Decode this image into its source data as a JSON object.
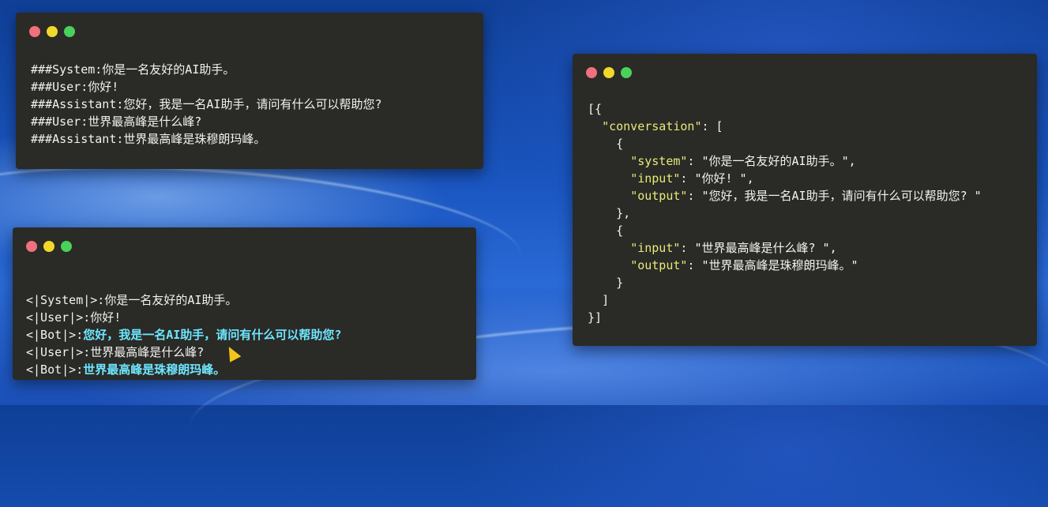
{
  "windows": {
    "top_left": {
      "lines": [
        "###System:你是一名友好的AI助手。",
        "###User:你好!",
        "###Assistant:您好，我是一名AI助手，请问有什么可以帮助您?",
        "###User:世界最高峰是什么峰?",
        "###Assistant:世界最高峰是珠穆朗玛峰。"
      ]
    },
    "bottom_left": {
      "lines": [
        {
          "prefix": "<|System|>:",
          "text": "你是一名友好的AI助手。"
        },
        {
          "prefix": "<|User|>:",
          "text": "你好!"
        },
        {
          "prefix": "<|Bot|>:",
          "text": "您好，我是一名AI助手，请问有什么可以帮助您?"
        },
        {
          "prefix": "<|User|>:",
          "text": "世界最高峰是什么峰?"
        },
        {
          "prefix": "<|Bot|>:",
          "text": "世界最高峰是珠穆朗玛峰。"
        }
      ]
    },
    "right": {
      "open": "[{",
      "conversation_key": "\"conversation\"",
      "conversation_rest": ": [",
      "brace_open": "{",
      "system_key": "\"system\"",
      "system_val": ": \"你是一名友好的AI助手。\",",
      "input1_key": "\"input\"",
      "input1_val": ": \"你好! \",",
      "output1_key": "\"output\"",
      "output1_val": ": \"您好，我是一名AI助手，请问有什么可以帮助您? \"",
      "brace_close_comma": "},",
      "input2_key": "\"input\"",
      "input2_val": ": \"世界最高峰是什么峰? \",",
      "output2_key": "\"output\"",
      "output2_val": ": \"世界最高峰是珠穆朗玛峰。\"",
      "brace_close": "}",
      "bracket_close": "]",
      "close": "}]"
    }
  },
  "colors": {
    "window_bg": "#2a2a26",
    "highlight_cyan": "#6ee6ff",
    "json_key_yellow": "#e8ea7a",
    "dot_red": "#f0707b",
    "dot_yellow": "#f2d82a",
    "dot_green": "#4ad15a"
  }
}
